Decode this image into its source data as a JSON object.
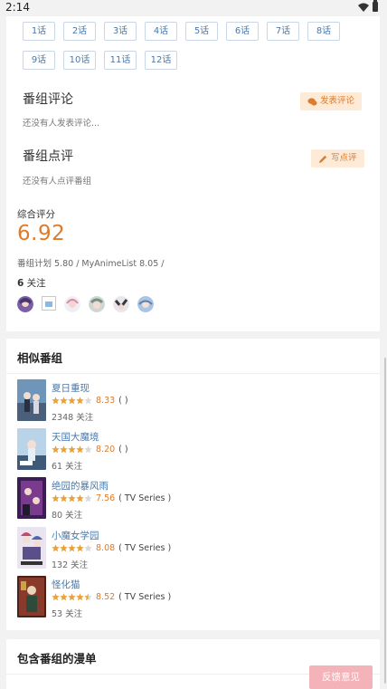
{
  "status_bar": {
    "time": "2:14"
  },
  "episodes": [
    "1话",
    "2话",
    "3话",
    "4话",
    "5话",
    "6话",
    "7话",
    "8话",
    "9话",
    "10话",
    "11话",
    "12话"
  ],
  "comments": {
    "title": "番组评论",
    "empty": "还没有人发表评论...",
    "button": "发表评论"
  },
  "reviews": {
    "title": "番组点评",
    "empty": "还没有人点评番组",
    "button": "写点评"
  },
  "rating": {
    "label": "综合评分",
    "value": "6.92",
    "sources": "番组计划 5.80 / MyAnimeList 8.05 /",
    "follow_num": "6",
    "follow_label": " 关注"
  },
  "similar": {
    "title": "相似番组",
    "items": [
      {
        "name": "夏日重现",
        "stars": 4,
        "score": "8.33",
        "type": "( )",
        "follow": "2348 关注",
        "accent": "#5a7ea6"
      },
      {
        "name": "天国大魔境",
        "stars": 4,
        "score": "8.20",
        "type": "( )",
        "follow": "61 关注",
        "accent": "#7fa3c4"
      },
      {
        "name": "绝园的暴风雨",
        "stars": 4,
        "score": "7.56",
        "type": "( TV Series )",
        "follow": "80 关注",
        "accent": "#7a3b8f"
      },
      {
        "name": "小魔女学园",
        "stars": 4,
        "score": "8.08",
        "type": "( TV Series )",
        "follow": "132 关注",
        "accent": "#4e66b0"
      },
      {
        "name": "怪化猫",
        "stars": 4.5,
        "score": "8.52",
        "type": "( TV Series )",
        "follow": "53 关注",
        "accent": "#8a3a2a"
      }
    ]
  },
  "manga": {
    "title": "包含番组的漫单"
  },
  "feedback": {
    "label": "反馈意见"
  },
  "colors": {
    "accent": "#e07b2a",
    "link": "#4a78a8",
    "star": "#e8a23a"
  }
}
